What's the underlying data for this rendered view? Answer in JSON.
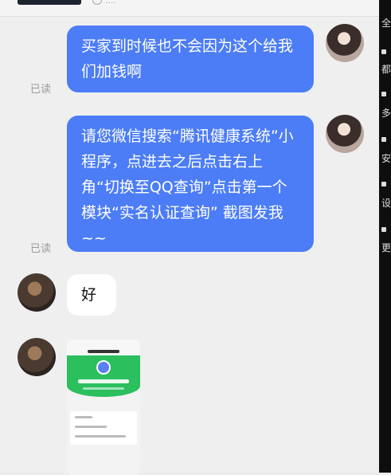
{
  "top_strip": {
    "text": "...."
  },
  "messages": [
    {
      "side": "me",
      "text": "买家到时候也不会因为这个给我们加钱啊",
      "read": "已读"
    },
    {
      "side": "me",
      "text": "请您微信搜索“腾讯健康系统”小程序，点进去之后点击右上角“切换至QQ查询”点击第一个模块“实名认证查询” 截图发我~~",
      "read": "已读"
    },
    {
      "side": "other",
      "text": "好"
    },
    {
      "side": "other",
      "type": "image",
      "image_desc": "phone screenshot"
    }
  ],
  "right_strip": {
    "glyphs": [
      "全",
      "都",
      "多",
      "安",
      "设",
      "更"
    ]
  }
}
